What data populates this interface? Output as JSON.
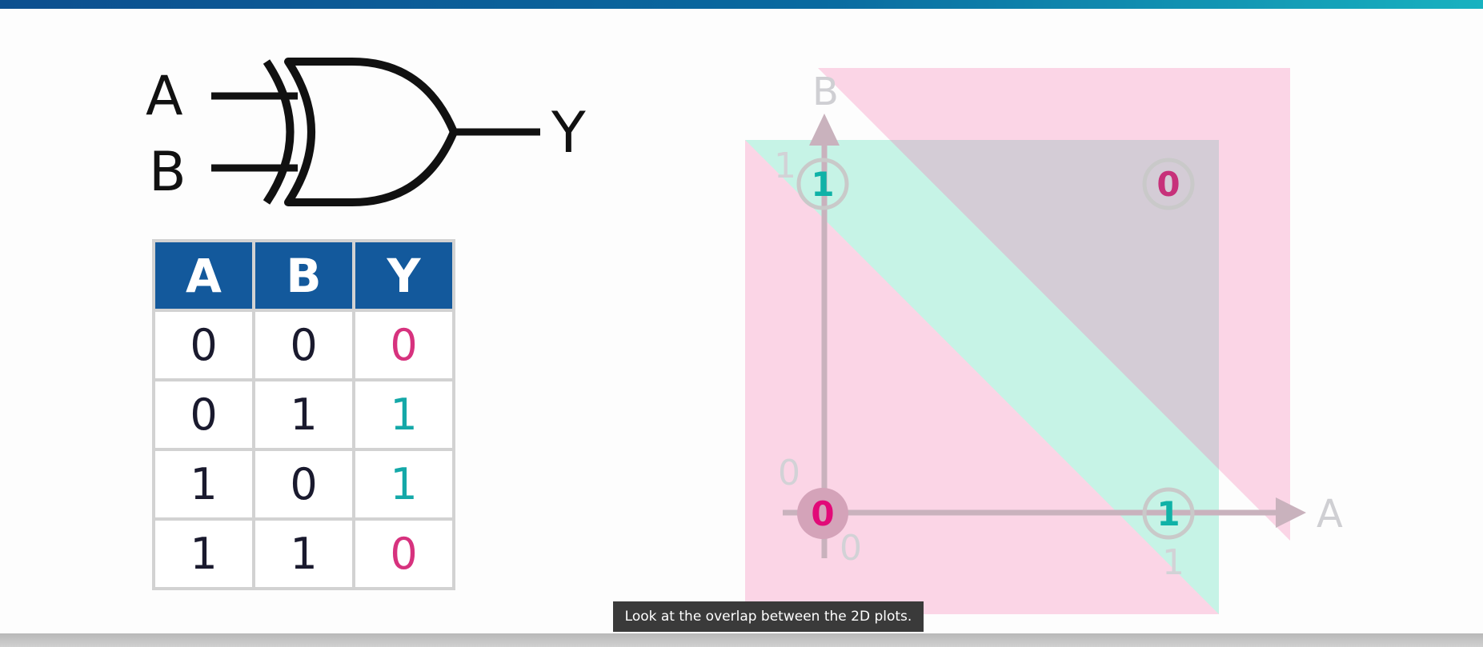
{
  "gate": {
    "inputs": [
      "A",
      "B"
    ],
    "output": "Y",
    "type": "XOR"
  },
  "truth_table": {
    "headers": [
      "A",
      "B",
      "Y"
    ],
    "rows": [
      [
        "0",
        "0",
        "0"
      ],
      [
        "0",
        "1",
        "1"
      ],
      [
        "1",
        "0",
        "1"
      ],
      [
        "1",
        "1",
        "0"
      ]
    ]
  },
  "plot": {
    "x_axis_label": "A",
    "y_axis_label": "B",
    "x_ticks": [
      "0",
      "1"
    ],
    "y_ticks": [
      "0",
      "1"
    ],
    "points": [
      {
        "a": 0,
        "b": 0,
        "value": "0"
      },
      {
        "a": 0,
        "b": 1,
        "value": "1"
      },
      {
        "a": 1,
        "b": 0,
        "value": "1"
      },
      {
        "a": 1,
        "b": 1,
        "value": "0"
      }
    ]
  },
  "caption": "Look at the overlap between the 2D plots.",
  "colors": {
    "header_blue": "#13599c",
    "output_zero": "#d7327e",
    "output_one": "#14a8a8",
    "pink_region": "#fbd5e6",
    "teal_region": "#c6f3e6",
    "gray_region": "#d4ccd6"
  }
}
